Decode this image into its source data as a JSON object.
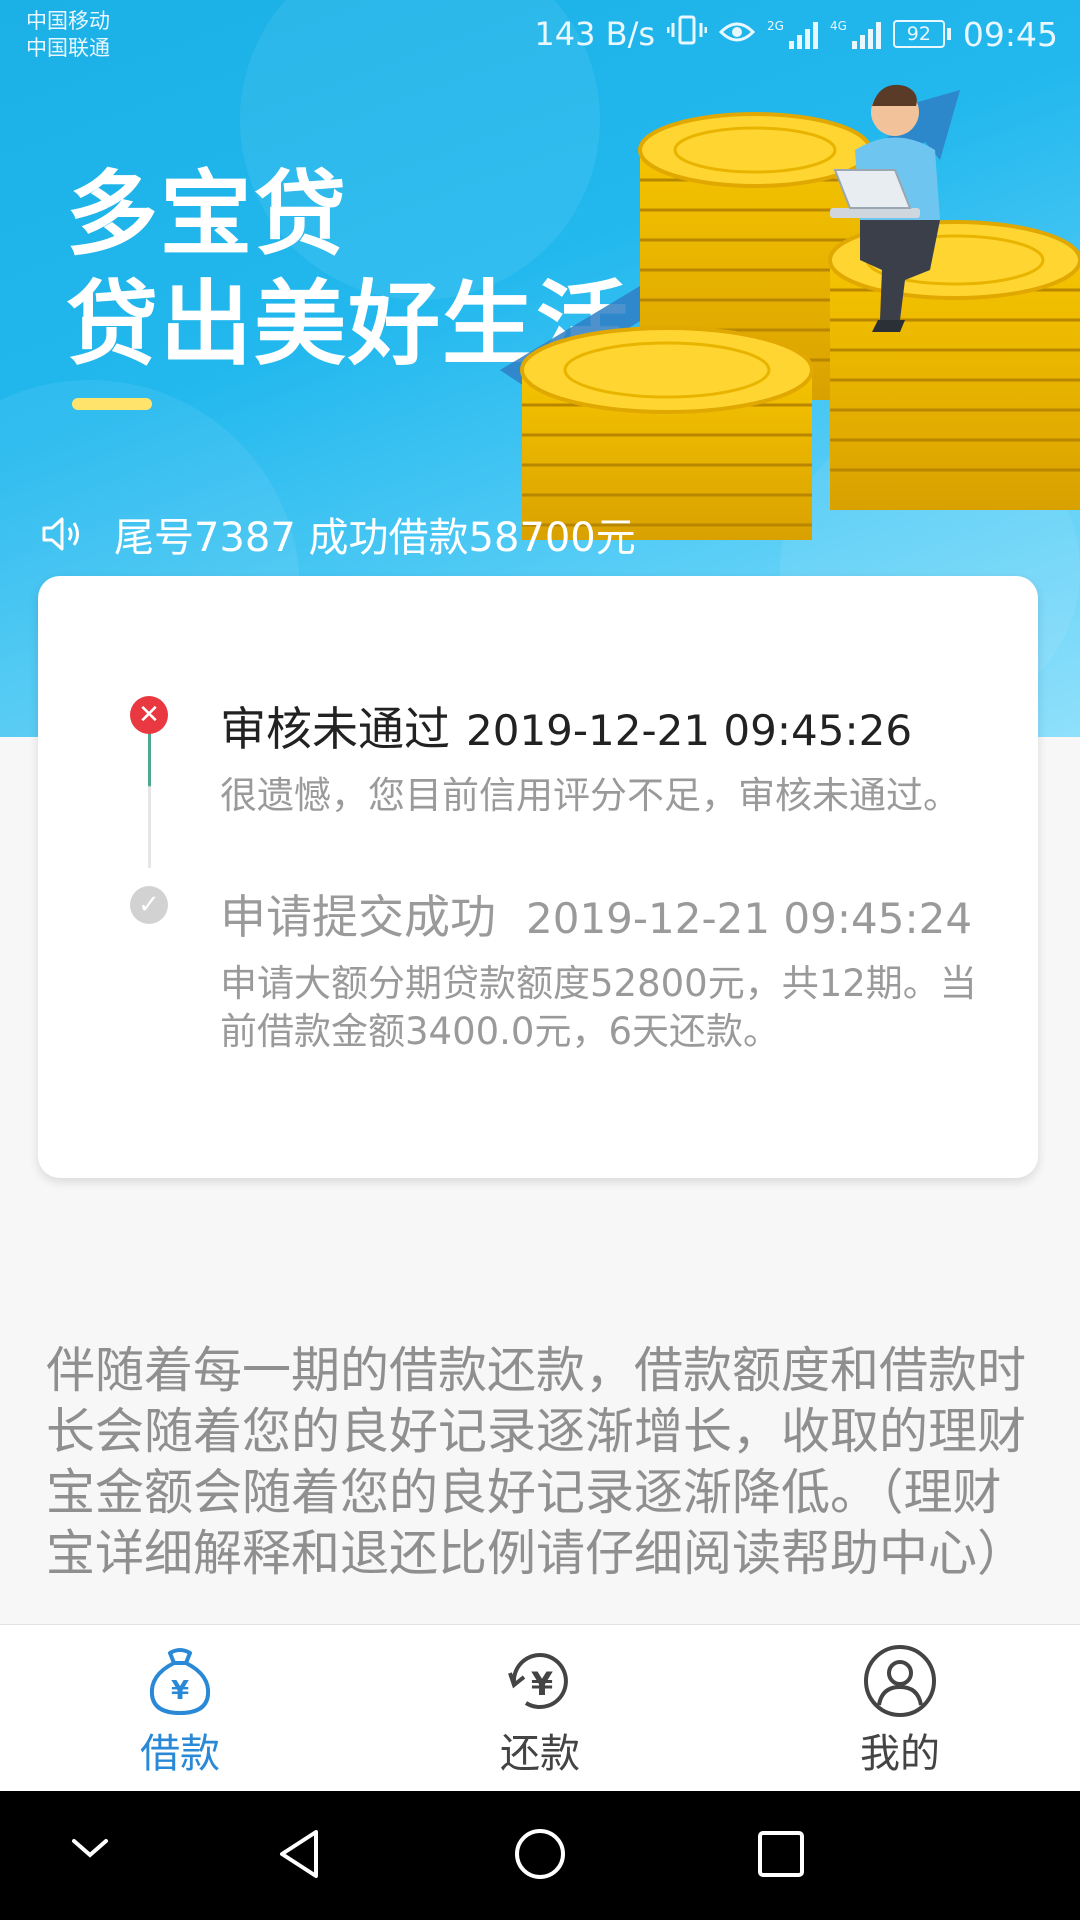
{
  "status_bar": {
    "carrier_1": "中国移动",
    "carrier_2": "中国联通",
    "net_speed": "143 B/s",
    "sim1_label": "2G",
    "sim2_label": "4G",
    "battery": "92",
    "time": "09:45"
  },
  "banner": {
    "brand": "多宝贷",
    "slogan": "贷出美好生活",
    "announcement": "尾号7387 成功借款58700元"
  },
  "timeline": [
    {
      "status": "审核未通过",
      "time": "2019-12-21 09:45:26",
      "description": "很遗憾，您目前信用评分不足，审核未通过。",
      "state": "failed"
    },
    {
      "status": "申请提交成功",
      "time": "2019-12-21 09:45:24",
      "description": "申请大额分期贷款额度52800元，共12期。当前借款金额3400.0元，6天还款。",
      "state": "done"
    }
  ],
  "info_text": "伴随着每一期的借款还款，借款额度和借款时长会随着您的良好记录逐渐增长，收取的理财宝金额会随着您的良好记录逐渐降低。（理财宝详细解释和退还比例请仔细阅读帮助中心）",
  "tabs": [
    {
      "label": "借款",
      "icon": "money-bag-icon",
      "active": true
    },
    {
      "label": "还款",
      "icon": "yuan-refresh-icon",
      "active": false
    },
    {
      "label": "我的",
      "icon": "user-icon",
      "active": false
    }
  ],
  "colors": {
    "banner": "#22b8ee",
    "accent": "#2a89d6",
    "fail": "#e9383f",
    "highlight_bar": "#ffe36a"
  }
}
